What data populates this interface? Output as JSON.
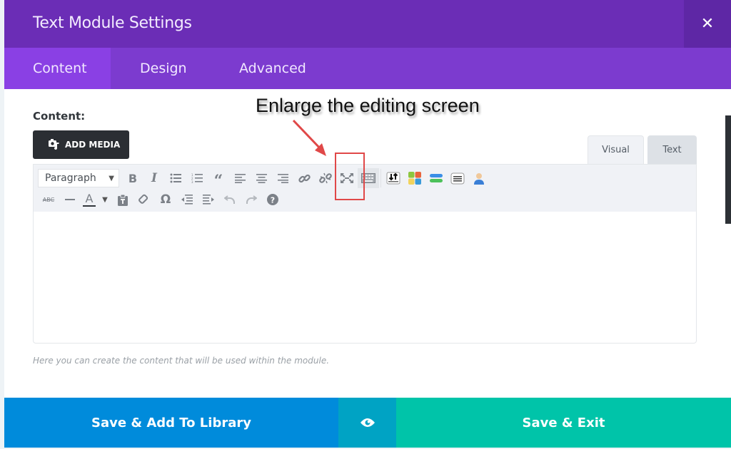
{
  "modal": {
    "title": "Text Module Settings",
    "close_icon": "close-icon",
    "tabs": [
      {
        "label": "Content",
        "active": true
      },
      {
        "label": "Design",
        "active": false
      },
      {
        "label": "Advanced",
        "active": false
      }
    ]
  },
  "content": {
    "label": "Content:",
    "add_media_label": "ADD MEDIA",
    "add_media_icon": "media-icon",
    "editor_tabs": [
      {
        "label": "Visual",
        "active": true
      },
      {
        "label": "Text",
        "active": false
      }
    ],
    "format_select": {
      "value": "Paragraph"
    },
    "toolbar_row1": [
      "bold",
      "italic",
      "bullet-list",
      "numbered-list",
      "blockquote",
      "align-left",
      "align-center",
      "align-right",
      "insert-link",
      "remove-link",
      "fullscreen",
      "toolbar-toggle",
      "shortcode-1",
      "shortcode-2",
      "shortcode-3",
      "shortcode-4",
      "shortcode-5"
    ],
    "toolbar_row2": [
      "strikethrough",
      "horizontal-line",
      "text-color",
      "paste-as-text",
      "clear-formatting",
      "special-character",
      "outdent",
      "indent",
      "undo",
      "redo",
      "keyboard-shortcuts"
    ],
    "editor_body": "",
    "help_text": "Here you can create the content that will be used within the module."
  },
  "annotation": {
    "text": "Enlarge the editing screen",
    "color": "#e04848"
  },
  "footer": {
    "save_library_label": "Save & Add To Library",
    "preview_icon": "eye-icon",
    "save_exit_label": "Save & Exit"
  },
  "colors": {
    "header": "#6b2db6",
    "tabs_bar": "#7c3bcf",
    "active_tab": "#8a40e4",
    "save_library": "#008bdb",
    "preview": "#00a3c4",
    "save_exit": "#00c4a9"
  }
}
